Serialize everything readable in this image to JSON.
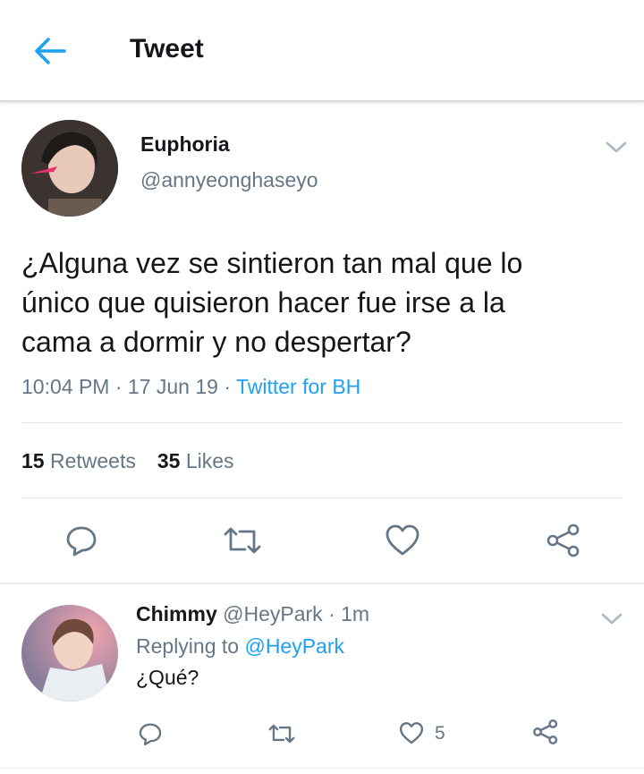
{
  "header": {
    "title": "Tweet",
    "back_icon": "arrow-left-icon",
    "accent_color": "#1da1f2"
  },
  "tweet": {
    "author_name": "Euphoria",
    "author_handle": "@annyeonghaseyo",
    "text_lines": [
      "¿Alguna vez se sintieron tan mal que lo",
      "único que quisieron hacer fue irse a la",
      "cama a dormir y no despertar?"
    ],
    "time": "10:04 PM",
    "sep1": " · ",
    "date": "17 Jun 19",
    "sep2": " · ",
    "source": "Twitter for BH",
    "retweets_count": "15",
    "retweets_label": "Retweets",
    "likes_count": "35",
    "likes_label": "Likes"
  },
  "reply": {
    "name": "Chimmy",
    "handle": "@HeyPark",
    "dot": " · ",
    "time": "1m",
    "replying_prefix": "Replying to",
    "replying_to": "@HeyPark",
    "text": "¿Qué?",
    "like_count": "5"
  },
  "icons": [
    "arrow-left-icon",
    "chevron-down-icon",
    "reply-icon",
    "retweet-icon",
    "heart-icon",
    "share-icon"
  ]
}
